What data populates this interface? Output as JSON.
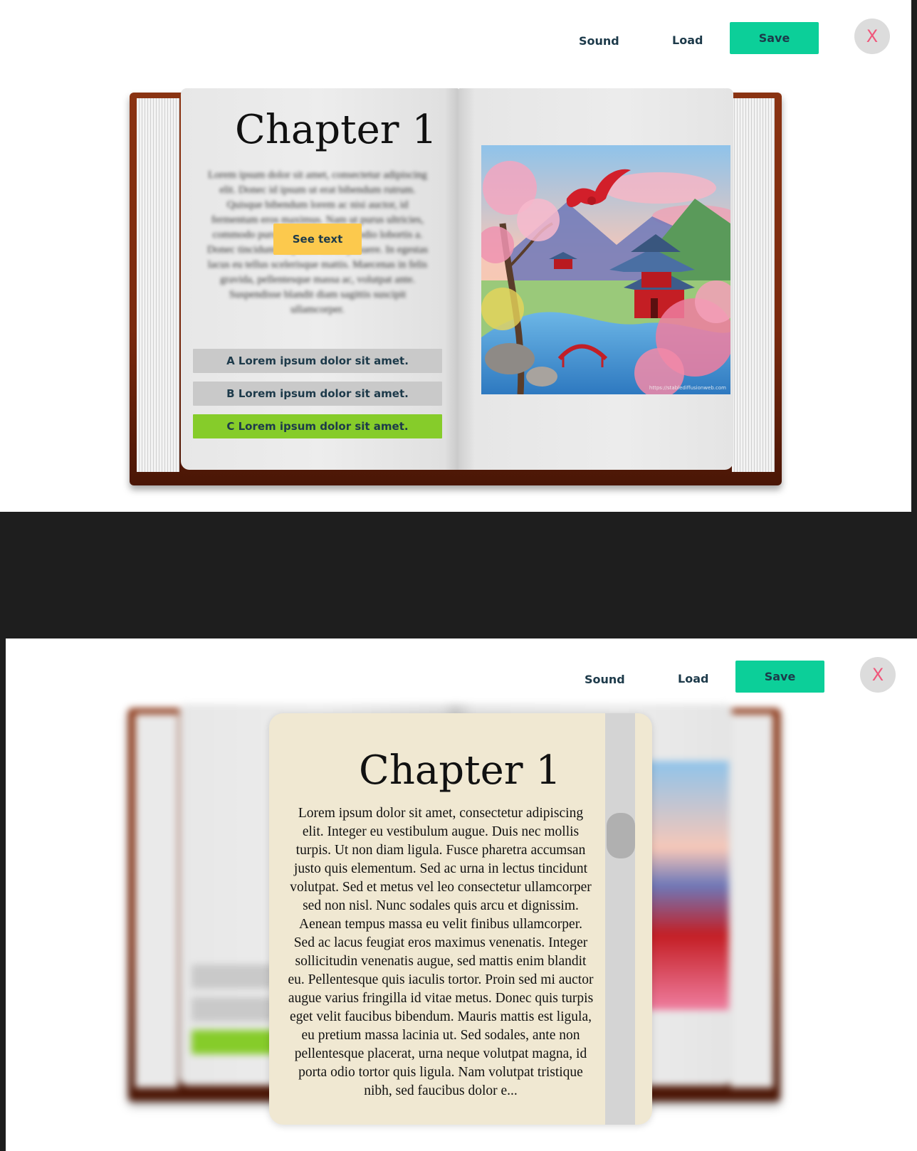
{
  "toolbar": {
    "sound_label": "Sound",
    "load_label": "Load",
    "save_label": "Save",
    "close_label": "X"
  },
  "book": {
    "chapter_title": "Chapter 1",
    "preview_text": "Lorem ipsum dolor sit amet, consectetur adipiscing elit. Donec id ipsum ut erat bibendum rutrum. Quisque bibendum lorem ac nisi auctor, id fermentum eros maximus. Nam ut purus ultricies, commodo purus. Proin bibendum odio lobortis a. Donec tincidunt vulputate mi ac posuere. In egestas lacus eu tellus scelerisque mattis. Maecenas in felis gravida, pellentesque massa ac, volutpat ante. Suspendisse blandit diam sagittis suscipit ullamcorper.",
    "see_text_label": "See text",
    "choices": [
      {
        "label": "A Lorem ipsum dolor sit amet.",
        "state": "default"
      },
      {
        "label": "B Lorem ipsum dolor sit amet.",
        "state": "default"
      },
      {
        "label": "C Lorem ipsum dolor sit amet.",
        "state": "selected"
      }
    ],
    "illustration_caption": "https://stablediffusionweb.com"
  },
  "modal": {
    "title": "Chapter 1",
    "body": "Lorem ipsum dolor sit amet, consectetur adipiscing elit. Integer eu vestibulum augue. Duis nec mollis turpis. Ut non diam ligula. Fusce pharetra accumsan justo quis elementum. Sed ac urna in lectus tincidunt volutpat. Sed et metus vel leo consectetur ullamcorper sed non nisl. Nunc sodales quis arcu et dignissim. Aenean tempus massa eu velit finibus ullamcorper. Sed ac lacus feugiat eros maximus venenatis. Integer sollicitudin venenatis augue, sed mattis enim blandit eu. Pellentesque quis iaculis tortor. Proin sed mi auctor augue varius fringilla id vitae metus. Donec quis turpis eget velit faucibus bibendum. Mauris mattis est ligula, eu pretium massa lacinia ut. Sed sodales, ante non pellentesque placerat, urna neque volutpat magna, id porta odio tortor quis ligula. Nam volutpat tristique nibh, sed faucibus dolor e..."
  },
  "colors": {
    "save_button": "#0ccf99",
    "see_text_button": "#fcc94d",
    "choice_default": "#c9c9c9",
    "choice_selected": "#86cc2a",
    "close_x": "#f0567a",
    "modal_bg": "#f0e8d2",
    "book_cover": "#7a2a0e"
  }
}
